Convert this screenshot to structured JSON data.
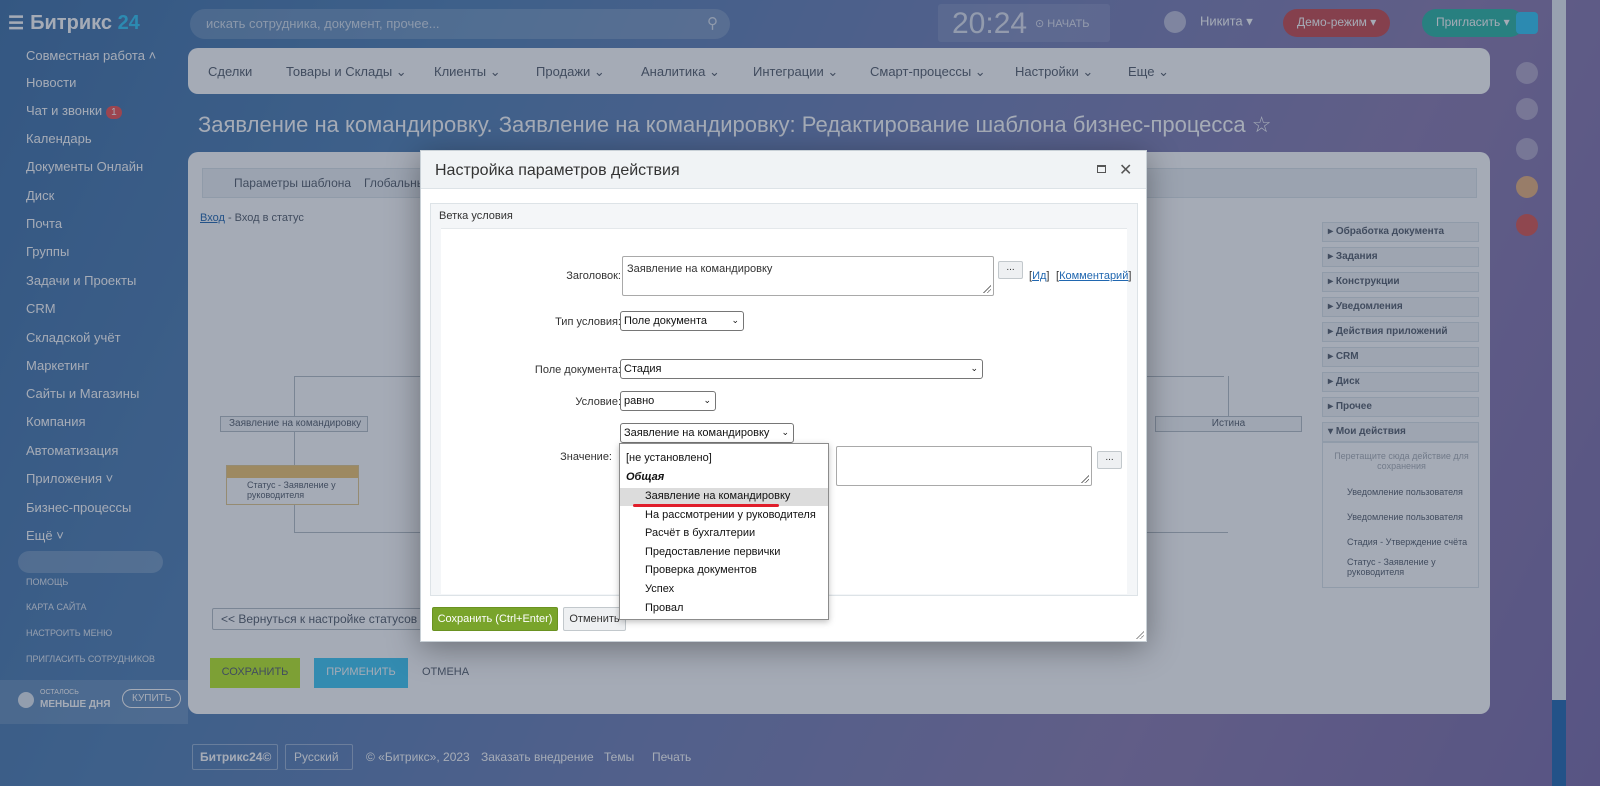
{
  "topbar": {
    "logo_text": "Битрикс",
    "logo_num": "24",
    "search_placeholder": "искать сотрудника, документ, прочее...",
    "clock": "20:24",
    "clock_status": "НАЧАТЬ",
    "user_name": "Никита",
    "demo_label": "Демо-режим",
    "invite_label": "Пригласить"
  },
  "leftmenu": {
    "items": [
      "Совместная работа",
      "Новости",
      "Чат и звонки",
      "Календарь",
      "Документы Онлайн",
      "Диск",
      "Почта",
      "Группы",
      "Задачи и Проекты",
      "CRM",
      "Складской учёт",
      "Маркетинг",
      "Сайты и Магазины",
      "Компания",
      "Автоматизация",
      "Приложения",
      "Бизнес-процессы",
      "Ещё"
    ],
    "chat_badge": "1",
    "small_links": [
      "ПОМОЩЬ",
      "КАРТА САЙТА",
      "НАСТРОИТЬ МЕНЮ",
      "ПРИГЛАСИТЬ СОТРУДНИКОВ"
    ],
    "trial_line1": "ОСТАЛОСЬ",
    "trial_line2": "МЕНЬШЕ ДНЯ",
    "buy_label": "КУПИТЬ"
  },
  "nav": {
    "items": [
      "Сделки",
      "Товары и Склады",
      "Клиенты",
      "Продажи",
      "Аналитика",
      "Интеграции",
      "Смарт-процессы",
      "Настройки",
      "Еще"
    ]
  },
  "page_title": "Заявление на командировку. Заявление на командировку: Редактирование шаблона бизнес-процесса",
  "tabs": [
    "Параметры шаблона",
    "Глобальные"
  ],
  "breadcrumb": {
    "link": "Вход",
    "rest": " - Вход в статус"
  },
  "workflow": {
    "branch_left": "Заявление на командировку",
    "branch_right": "Истина",
    "activity": "Статус - Заявление у руководителя",
    "back_button": "<< Вернуться к настройке статусов",
    "save": "СОХРАНИТЬ",
    "apply": "ПРИМЕНИТЬ",
    "cancel": "ОТМЕНА"
  },
  "palette": {
    "groups": [
      "Обработка документа",
      "Задания",
      "Конструкции",
      "Уведомления",
      "Действия приложений",
      "CRM",
      "Диск",
      "Прочее",
      "Мои действия"
    ],
    "hint": "Перетащите сюда действие для сохранения",
    "actions": [
      "Уведомление пользователя",
      "Уведомление пользователя",
      "Стадия - Утверждение счёта",
      "Статус - Заявление у руководителя"
    ]
  },
  "footer": {
    "brand": "Битрикс24©",
    "lang": "Русский",
    "copyright": "© «Битрикс», 2023",
    "order": "Заказать внедрение",
    "themes": "Темы",
    "print": "Печать"
  },
  "dialog": {
    "title": "Настройка параметров действия",
    "section": "Ветка условия",
    "fields": {
      "title_label": "Заголовок:",
      "title_value": "Заявление на командировку",
      "id_link": "Ид",
      "comment_link": "Комментарий",
      "type_label": "Тип условия:",
      "type_value": "Поле документа",
      "field_label": "Поле документа:",
      "field_value": "Стадия",
      "cond_label": "Условие:",
      "cond_value": "равно",
      "value_label": "Значение:",
      "value_select": "Заявление на командировку",
      "dots": "..."
    },
    "dropdown": {
      "unset": "[не установлено]",
      "group": "Общая",
      "options": [
        "Заявление на командировку",
        "На рассмотрении у руководителя",
        "Расчёт в бухгалтерии",
        "Предоставление первички",
        "Проверка документов",
        "Успех",
        "Провал"
      ],
      "selected_index": 0
    },
    "save_button": "Сохранить (Ctrl+Enter)",
    "cancel_button": "Отменить"
  }
}
